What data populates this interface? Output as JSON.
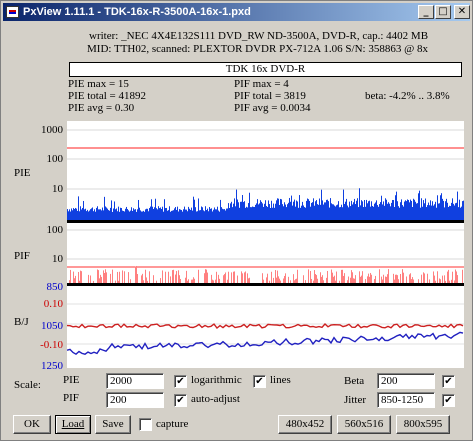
{
  "window": {
    "title": "PxView 1.11.1  -  TDK-16x-R-3500A-16x-1.pxd"
  },
  "titlebar_buttons": {
    "minimize": "_",
    "maximize": "□",
    "close": "✕"
  },
  "info": {
    "line1": "writer: _NEC 4X4E132S111 DVD_RW ND-3500A, DVD-R, cap.: 4402 MB",
    "line2": "MID: TTH02, scanned: PLEXTOR DVDR PX-712A 1.06 S/N: 358863 @ 8x"
  },
  "disc_title": "TDK 16x DVD-R",
  "stats": {
    "pie_max": "PIE max = 15",
    "pie_total": "PIE total = 41892",
    "pie_avg": "PIE avg = 0.30",
    "pif_max": "PIF max = 4",
    "pif_total": "PIF total = 3819",
    "pif_avg": "PIF avg = 0.0034",
    "beta": "beta: -4.2% .. 3.8%"
  },
  "pie_axis": {
    "label": "PIE",
    "ticks": [
      "1000",
      "100",
      "10"
    ]
  },
  "pif_axis": {
    "label": "PIF",
    "ticks": [
      "100",
      "10"
    ]
  },
  "bj_axis": {
    "label": "B/J",
    "ticks_left": [
      "850",
      "0.10",
      "1050",
      "-0.10",
      "1250"
    ]
  },
  "colors": {
    "pie": "#1040e0",
    "pif": "#ff8080",
    "beta": "#cc2020",
    "jitter": "#2020c0",
    "limit": "#ff0000",
    "axis_blue": "#0000cc",
    "axis_red": "#cc0000"
  },
  "controls": {
    "scale_label": "Scale:",
    "pie_label": "PIE",
    "pie_value": "2000",
    "pif_label": "PIF",
    "pif_value": "200",
    "logarithmic_label": "logarithmic",
    "logarithmic_checked": "✔",
    "lines_label": "lines",
    "lines_checked": "✔",
    "auto_adjust_label": "auto-adjust",
    "auto_adjust_checked": "✔",
    "beta_label": "Beta",
    "beta_value": "200",
    "beta_checked": "✔",
    "jitter_label": "Jitter",
    "jitter_value": "850-1250",
    "jitter_checked": "✔",
    "capture_label": "capture"
  },
  "buttons": {
    "ok": "OK",
    "load": "Load",
    "save": "Save",
    "size1": "480x452",
    "size2": "560x516",
    "size3": "800x595"
  }
}
